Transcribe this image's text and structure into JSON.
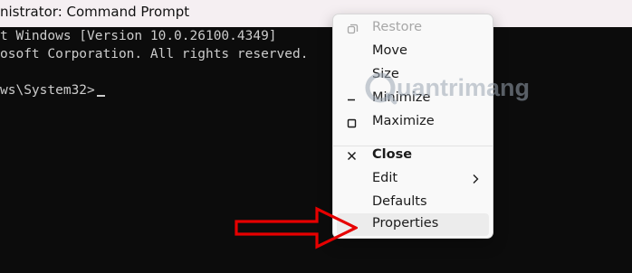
{
  "window": {
    "title": "nistrator: Command Prompt"
  },
  "console": {
    "lines": [
      "t Windows [Version 10.0.26100.4349]",
      "osoft Corporation. All rights reserved.",
      "ws\\System32>"
    ]
  },
  "watermark": {
    "text": "uantrimang"
  },
  "context_menu": {
    "items": [
      {
        "label": "Restore",
        "icon": "restore-icon",
        "state": "disabled"
      },
      {
        "label": "Move"
      },
      {
        "label": "Size"
      },
      {
        "label": "Minimize",
        "icon": "minimize-icon"
      },
      {
        "label": "Maximize",
        "icon": "maximize-icon"
      },
      {
        "label": "Close",
        "icon": "close-icon",
        "emphasis": "bold"
      },
      {
        "label": "Edit",
        "submenu": true
      },
      {
        "label": "Defaults"
      },
      {
        "label": "Properties",
        "state": "highlighted"
      }
    ]
  },
  "colors": {
    "titlebar": "#f5eff2",
    "console_bg": "#0c0c0c",
    "console_text": "#cccccc",
    "menu_bg": "#f9f9f9",
    "arrow": "#e60000"
  }
}
